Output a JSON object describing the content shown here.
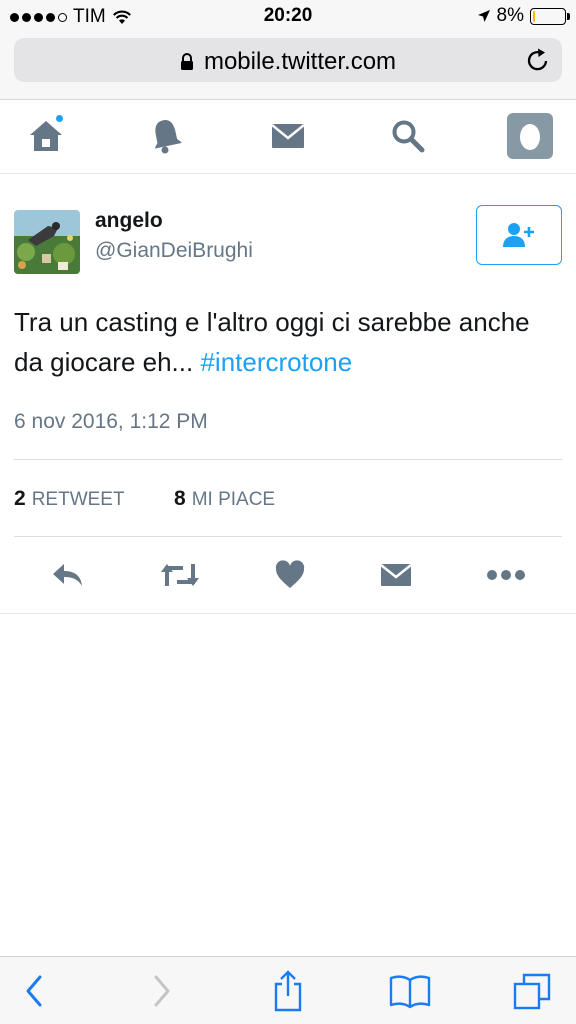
{
  "status_bar": {
    "carrier": "TIM",
    "time": "20:20",
    "battery": "8%",
    "battery_level": 0.08,
    "signal_bars": 4
  },
  "browser": {
    "url": "mobile.twitter.com"
  },
  "nav": {
    "items": [
      {
        "name": "home",
        "icon": "home-icon",
        "has_notification": true
      },
      {
        "name": "notifications",
        "icon": "bell-icon"
      },
      {
        "name": "messages",
        "icon": "envelope-icon"
      },
      {
        "name": "search",
        "icon": "search-icon"
      },
      {
        "name": "profile",
        "icon": "avatar-icon"
      }
    ]
  },
  "tweet": {
    "display_name": "angelo",
    "handle": "@GianDeiBrughi",
    "text": "Tra un casting e l'altro oggi ci sarebbe anche da giocare eh... ",
    "hashtag": "#intercrotone",
    "timestamp": "6 nov 2016, 1:12 PM",
    "retweets_count": "2",
    "retweets_label": "RETWEET",
    "likes_count": "8",
    "likes_label": "MI PIACE"
  },
  "colors": {
    "accent": "#1da1f2",
    "icon_gray": "#657786",
    "text": "#14171a",
    "safari_blue": "#1a7cf2"
  }
}
